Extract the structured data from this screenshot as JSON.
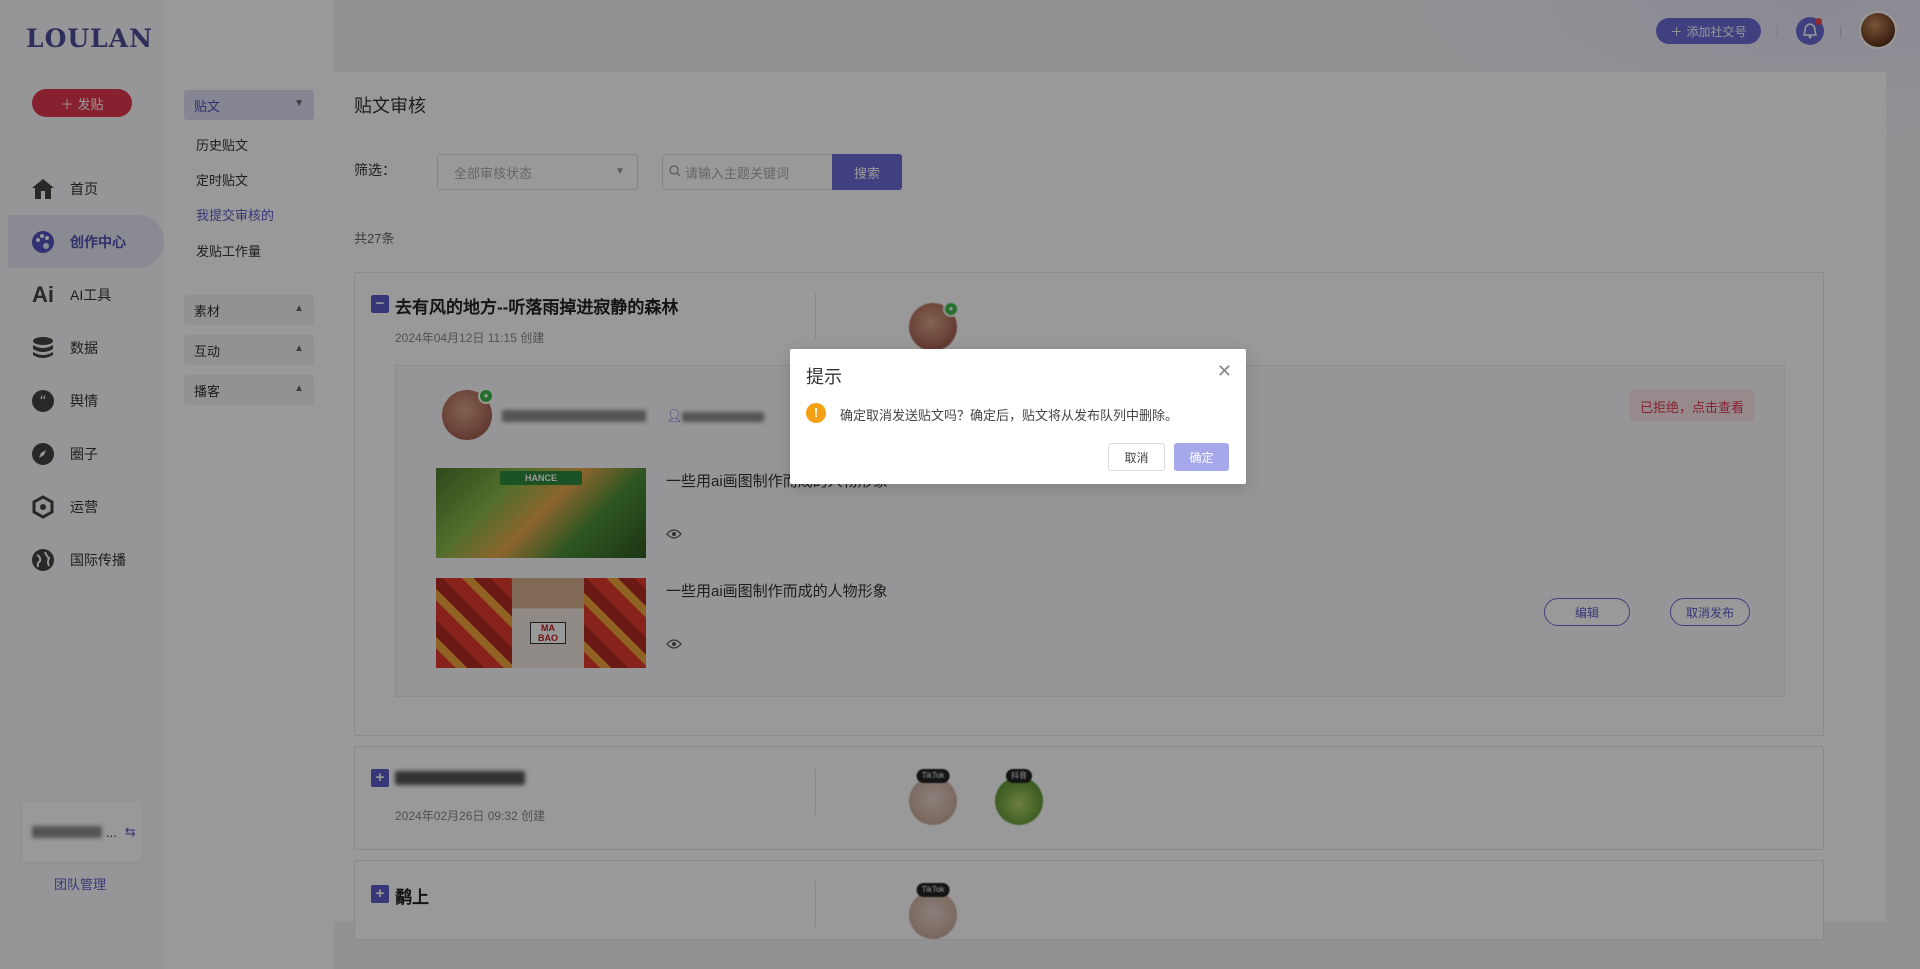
{
  "brand": {
    "logo": "LOULAN",
    "post_button": "发贴"
  },
  "nav": {
    "items": [
      {
        "label": "首页",
        "icon": "home-icon"
      },
      {
        "label": "创作中心",
        "icon": "palette-icon",
        "active": true
      },
      {
        "label": "AI工具",
        "icon": "ai-icon"
      },
      {
        "label": "数据",
        "icon": "database-icon"
      },
      {
        "label": "舆情",
        "icon": "quote-icon"
      },
      {
        "label": "圈子",
        "icon": "compass-icon"
      },
      {
        "label": "运营",
        "icon": "operations-icon"
      },
      {
        "label": "国际传播",
        "icon": "globe-icon"
      }
    ],
    "team_manage": "团队管理"
  },
  "subnav": {
    "posts_header": "贴文",
    "posts_items": [
      "历史贴文",
      "定时贴文",
      "我提交审核的",
      "发贴工作量"
    ],
    "selected": "我提交审核的",
    "material": "素材",
    "interaction": "互动",
    "broadcast": "播客"
  },
  "topbar": {
    "add_social": "添加社交号"
  },
  "page": {
    "title": "贴文审核",
    "filter_label": "筛选：",
    "status_placeholder": "全部审核状态",
    "search_placeholder": "请输入主题关键词",
    "search_button": "搜索",
    "total": "共27条"
  },
  "cards": [
    {
      "title": "去有风的地方--听落雨掉进寂静的森林",
      "date": "2024年04月12日 11:15 创建",
      "expanded": true,
      "rejected_label": "已拒绝，点击查看",
      "posts": [
        {
          "text": "一些用ai画图制作而成的人物形象",
          "thumb_banner": "HANCE"
        },
        {
          "text": "一些用ai画图制作而成的人物形象",
          "thumb_label": "MA BAO"
        }
      ],
      "edit_button": "编辑",
      "unpublish_button": "取消发布"
    },
    {
      "date": "2024年02月26日 09:32 创建",
      "badges": [
        "TikTok",
        "抖音"
      ]
    },
    {
      "title": "鹬上",
      "badges": [
        "TikTok"
      ]
    }
  ],
  "dialog": {
    "title": "提示",
    "message": "确定取消发送贴文吗？确定后，贴文将从发布队列中删除。",
    "cancel": "取消",
    "confirm": "确定"
  },
  "colors": {
    "accent": "#6b6bd6",
    "post_button": "#e3384f",
    "warning": "#f4a014"
  }
}
